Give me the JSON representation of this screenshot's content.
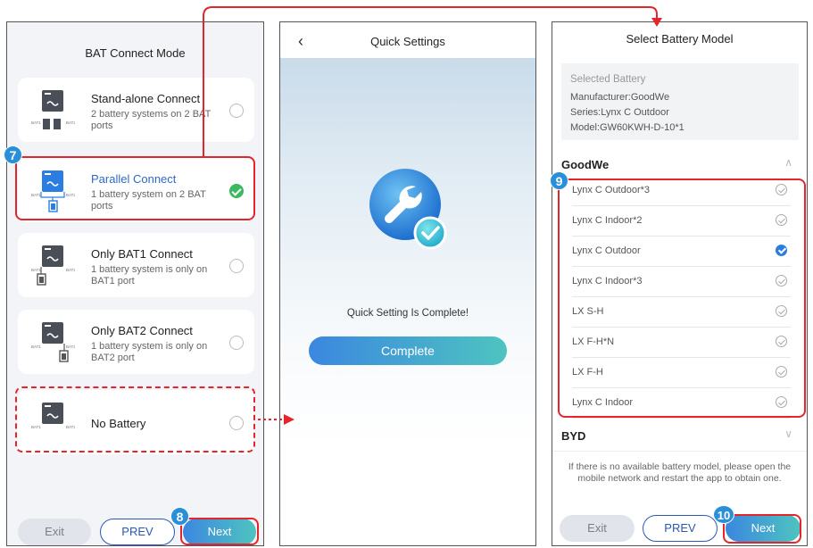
{
  "screen1": {
    "title": "BAT Connect Mode",
    "modes": [
      {
        "name": "Stand-alone Connect",
        "desc": "2 battery systems on 2 BAT ports",
        "selected": false
      },
      {
        "name": "Parallel Connect",
        "desc": "1 battery system on 2 BAT ports",
        "selected": true
      },
      {
        "name": "Only BAT1 Connect",
        "desc": "1 battery system is only on BAT1 port",
        "selected": false
      },
      {
        "name": "Only BAT2 Connect",
        "desc": "1 battery system is only on BAT2 port",
        "selected": false
      },
      {
        "name": "No Battery",
        "desc": "",
        "selected": false
      }
    ],
    "port_labels": {
      "bat1": "BAT1",
      "bat2": "BAT2"
    },
    "buttons": {
      "exit": "Exit",
      "prev": "PREV",
      "next": "Next"
    }
  },
  "screen2": {
    "title": "Quick Settings",
    "back_icon": "chevron-left-icon",
    "message": "Quick Setting Is Complete!",
    "complete_label": "Complete"
  },
  "screen3": {
    "title": "Select Battery Model",
    "selected": {
      "heading": "Selected Battery",
      "manufacturer": "Manufacturer:GoodWe",
      "series": "Series:Lynx C Outdoor",
      "model": "Model:GW60KWH-D-10*1"
    },
    "brands": [
      {
        "name": "GoodWe",
        "expanded": true
      },
      {
        "name": "BYD",
        "expanded": false
      }
    ],
    "models": [
      {
        "name": "Lynx C Outdoor*3",
        "selected": false
      },
      {
        "name": "Lynx C Indoor*2",
        "selected": false
      },
      {
        "name": "Lynx C Outdoor",
        "selected": true
      },
      {
        "name": "Lynx C Indoor*3",
        "selected": false
      },
      {
        "name": "LX S-H",
        "selected": false
      },
      {
        "name": "LX F-H*N",
        "selected": false
      },
      {
        "name": "LX F-H",
        "selected": false
      },
      {
        "name": "Lynx C Indoor",
        "selected": false
      }
    ],
    "notice": "If there is no available battery model, please open the mobile network and restart the app to obtain one.",
    "buttons": {
      "exit": "Exit",
      "prev": "PREV",
      "next": "Next"
    }
  },
  "annotations": {
    "step7": "7",
    "step8": "8",
    "step9": "9",
    "step10": "10"
  },
  "colors": {
    "highlight": "#e4262c",
    "badge": "#2a8fd9",
    "accent": "#2b58b5",
    "check_green": "#3cb95f"
  }
}
